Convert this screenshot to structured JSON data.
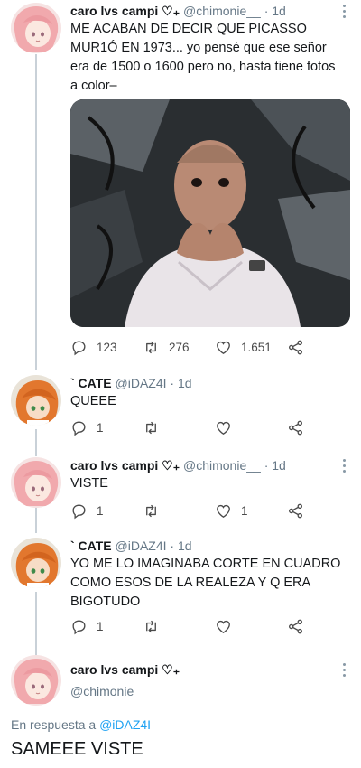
{
  "tweets": [
    {
      "name": "caro lvs campi ♡₊",
      "handle": "@chimonie__",
      "dot": "·",
      "time": "1d",
      "text": "ME ACABAN DE DECIR QUE PICASSO MUR1Ó EN 1973... yo pensé que ese señor era de 1500 o 1600 pero no, hasta tiene fotos a color–",
      "replies": "123",
      "retweets": "276",
      "likes": "1.651"
    },
    {
      "name": "` CATE",
      "handle": "@iDAZ4I",
      "dot": "·",
      "time": "1d",
      "text": "QUEEE",
      "replies": "1",
      "retweets": "",
      "likes": ""
    },
    {
      "name": "caro lvs campi ♡₊",
      "handle": "@chimonie__",
      "dot": "·",
      "time": "1d",
      "text": "VISTE",
      "replies": "1",
      "retweets": "",
      "likes": "1"
    },
    {
      "name": "` CATE",
      "handle": "@iDAZ4I",
      "dot": "·",
      "time": "1d",
      "text": "YO ME LO IMAGINABA CORTE EN CUADRO COMO ESOS DE LA REALEZA Y Q ERA BIGOTUDO",
      "replies": "1",
      "retweets": "",
      "likes": ""
    }
  ],
  "focused": {
    "name": "caro lvs campi ♡₊",
    "handle": "@chimonie__",
    "reply_prefix": "En respuesta a",
    "reply_handle": "@iDAZ4I",
    "text": "SAMEEE VISTE"
  },
  "colors": {
    "link": "#1da1f2",
    "muted": "#657786",
    "thread_line": "#c9d1d8"
  },
  "icons": [
    "reply-icon",
    "retweet-icon",
    "like-icon",
    "share-icon",
    "more-icon"
  ]
}
